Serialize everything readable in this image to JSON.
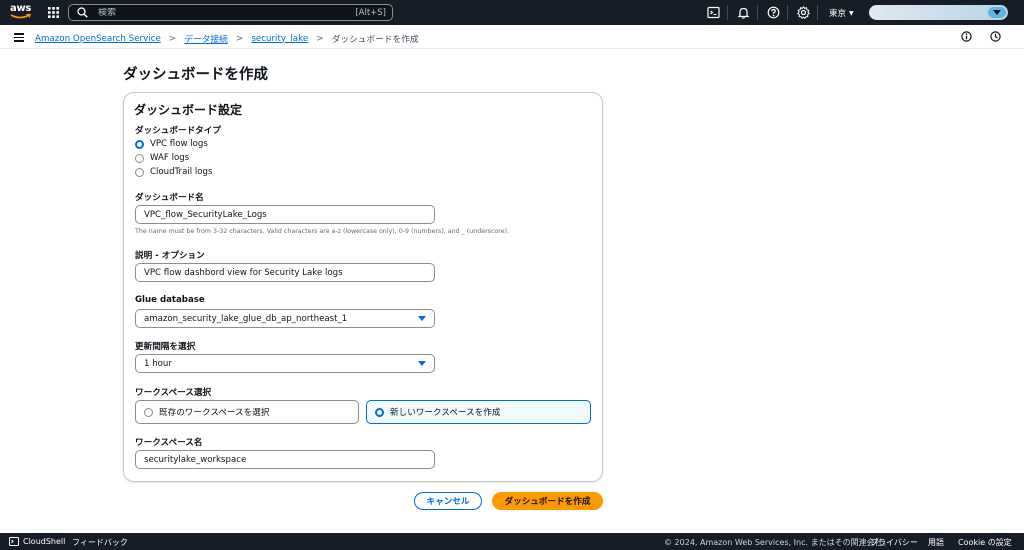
{
  "topnav": {
    "logo_text": "aws",
    "search_placeholder": "検索",
    "search_shortcut": "[Alt+S]",
    "region": "東京",
    "icons": [
      "grid-icon",
      "search-icon",
      "cloudshell-icon",
      "bell-icon",
      "help-icon",
      "gear-icon"
    ]
  },
  "breadcrumb": {
    "items": [
      "Amazon OpenSearch Service",
      "データ接続",
      "security_lake"
    ],
    "current": "ダッシュボードを作成"
  },
  "page": {
    "title": "ダッシュボードを作成"
  },
  "form": {
    "section_title": "ダッシュボード設定",
    "type_label": "ダッシュボードタイプ",
    "type_options": [
      "VPC flow logs",
      "WAF logs",
      "CloudTrail logs"
    ],
    "type_selected": "VPC flow logs",
    "name_label": "ダッシュボード名",
    "name_value": "VPC_flow_SecurityLake_Logs",
    "name_hint": "The name must be from 3-32 characters. Valid characters are a-z (lowercase only), 0-9 (numbers), and _ (underscore).",
    "desc_label": "説明 - オプション",
    "desc_value": "VPC flow dashbord view for Security Lake logs",
    "db_label": "Glue database",
    "db_value": "amazon_security_lake_glue_db_ap_northeast_1",
    "interval_label": "更新間隔を選択",
    "interval_value": "1 hour",
    "workspace_label": "ワークスペース選択",
    "workspace_options": [
      "既存のワークスペースを選択",
      "新しいワークスペースを作成"
    ],
    "workspace_selected": "新しいワークスペースを作成",
    "workspace_name_label": "ワークスペース名",
    "workspace_name_value": "securitylake_workspace"
  },
  "actions": {
    "cancel": "キャンセル",
    "create": "ダッシュボードを作成"
  },
  "footer": {
    "cloudshell": "CloudShell",
    "feedback": "フィードバック",
    "copyright": "© 2024, Amazon Web Services, Inc. またはその関連会社。",
    "privacy": "プライバシー",
    "terms": "用語",
    "cookie": "Cookie の設定"
  },
  "colors": {
    "nav_bg": "#161d26",
    "link": "#006ce0",
    "primary_button": "#ff9900",
    "selected_tile_bg": "#f0fbff"
  }
}
